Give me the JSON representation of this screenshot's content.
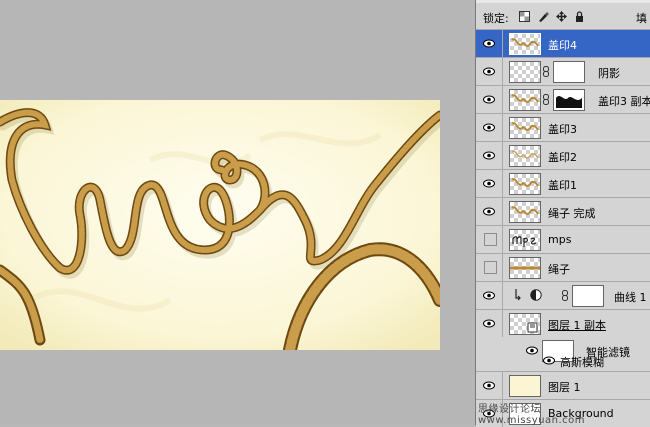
{
  "panel": {
    "lock_label": "锁定:",
    "fill_label": "填",
    "layers": [
      {
        "name": "盖印4",
        "visible": true,
        "selected": true
      },
      {
        "name": "阴影",
        "visible": true,
        "selected": false
      },
      {
        "name": "盖印3 副本",
        "visible": true,
        "selected": false
      },
      {
        "name": "盖印3",
        "visible": true,
        "selected": false
      },
      {
        "name": "盖印2",
        "visible": true,
        "selected": false
      },
      {
        "name": "盖印1",
        "visible": true,
        "selected": false
      },
      {
        "name": "绳子 完成",
        "visible": true,
        "selected": false
      },
      {
        "name": "mps",
        "visible": false,
        "selected": false
      },
      {
        "name": "绳子",
        "visible": false,
        "selected": false
      },
      {
        "name": "曲线 1",
        "visible": true,
        "selected": false
      },
      {
        "name": "图层 1 副本",
        "visible": true,
        "selected": false
      },
      {
        "name": "智能滤镜",
        "visible": true,
        "selected": false
      },
      {
        "name": "高斯模糊",
        "visible": true,
        "selected": false
      },
      {
        "name": "图层 1",
        "visible": true,
        "selected": false
      },
      {
        "name": "Background",
        "visible": true,
        "selected": false
      }
    ]
  },
  "watermark": "思缘设计论坛  www.missyuan.com",
  "colors": {
    "selection": "#3566c5",
    "rope": "#b58a3a",
    "canvas_bg": "#fbf7d8"
  }
}
